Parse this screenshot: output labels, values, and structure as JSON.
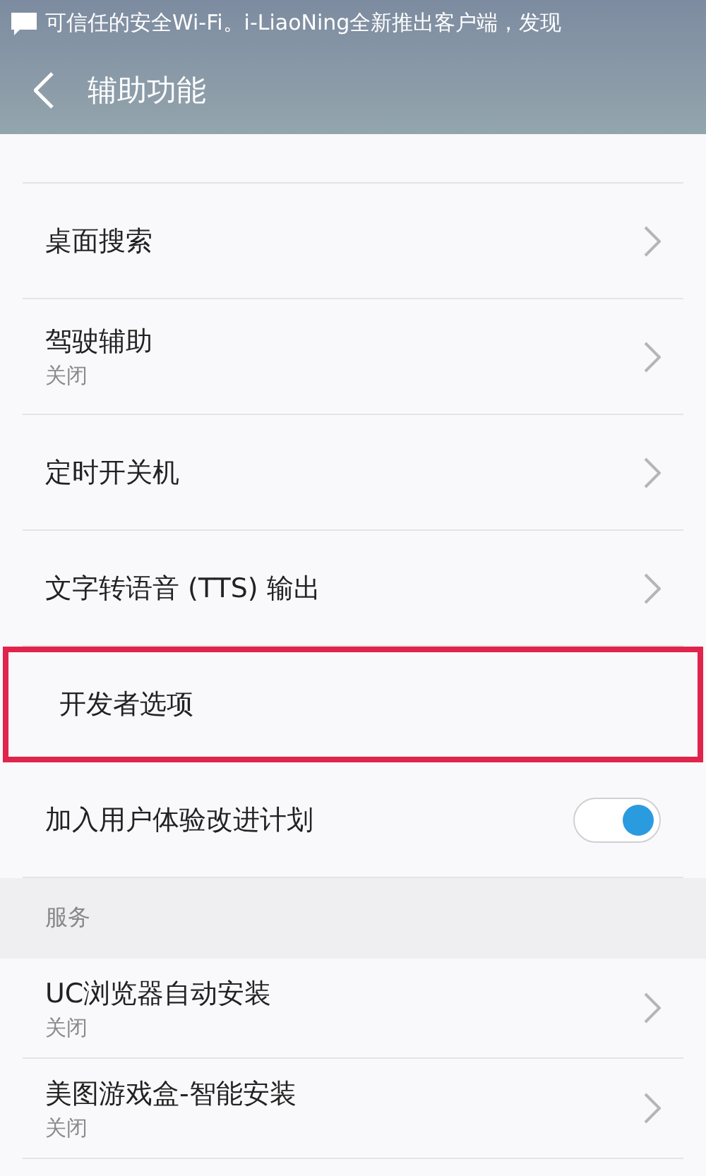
{
  "status_bar": {
    "notification": "可信任的安全Wi-Fi。i-LiaoNing全新推出客户端，发现"
  },
  "header": {
    "title": "辅助功能"
  },
  "sections": [
    {
      "items": [
        {
          "kind": "cut"
        },
        {
          "kind": "link",
          "title": "桌面搜索",
          "highlighted": false
        },
        {
          "kind": "link",
          "title": "驾驶辅助",
          "subtitle": "关闭",
          "highlighted": false
        },
        {
          "kind": "link",
          "title": "定时开关机",
          "highlighted": false
        },
        {
          "kind": "link",
          "title": "文字转语音 (TTS) 输出",
          "highlighted": false
        },
        {
          "kind": "plain",
          "title": "开发者选项",
          "highlighted": true
        },
        {
          "kind": "toggle",
          "title": "加入用户体验改进计划",
          "on": true,
          "highlighted": false
        }
      ]
    },
    {
      "heading": "服务",
      "items": [
        {
          "kind": "link",
          "title": "UC浏览器自动安装",
          "subtitle": "关闭",
          "highlighted": false
        },
        {
          "kind": "link",
          "title": "美图游戏盒-智能安装",
          "subtitle": "关闭",
          "highlighted": false
        }
      ]
    }
  ]
}
